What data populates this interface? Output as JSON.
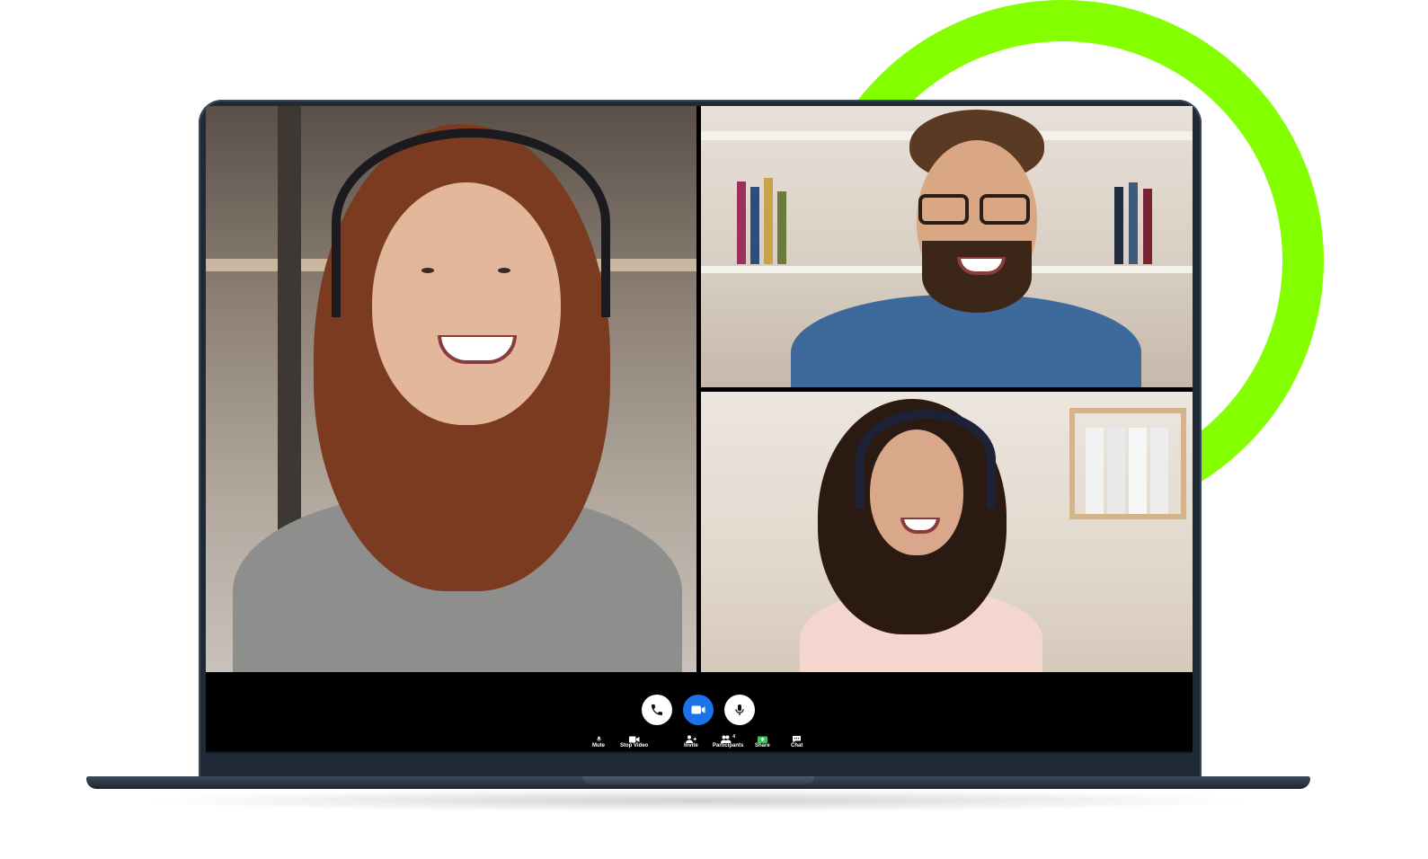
{
  "colors": {
    "ring": "#84ff00",
    "video_button": "#1a73e8",
    "share_icon": "#2ecc40"
  },
  "call": {
    "participants_in_grid": [
      {
        "tile": "main"
      },
      {
        "tile": "top-right"
      },
      {
        "tile": "bottom-right"
      }
    ],
    "round_buttons": [
      {
        "name": "end-call",
        "icon": "phone-icon"
      },
      {
        "name": "video",
        "icon": "video-camera-icon"
      },
      {
        "name": "microphone",
        "icon": "microphone-icon"
      }
    ]
  },
  "toolbar": {
    "mute_label": "Mute",
    "stop_video_label": "Stop Video",
    "invite_label": "Invite",
    "participants_label": "Participants",
    "participants_count": "4",
    "share_label": "Share",
    "chat_label": "Chat"
  }
}
